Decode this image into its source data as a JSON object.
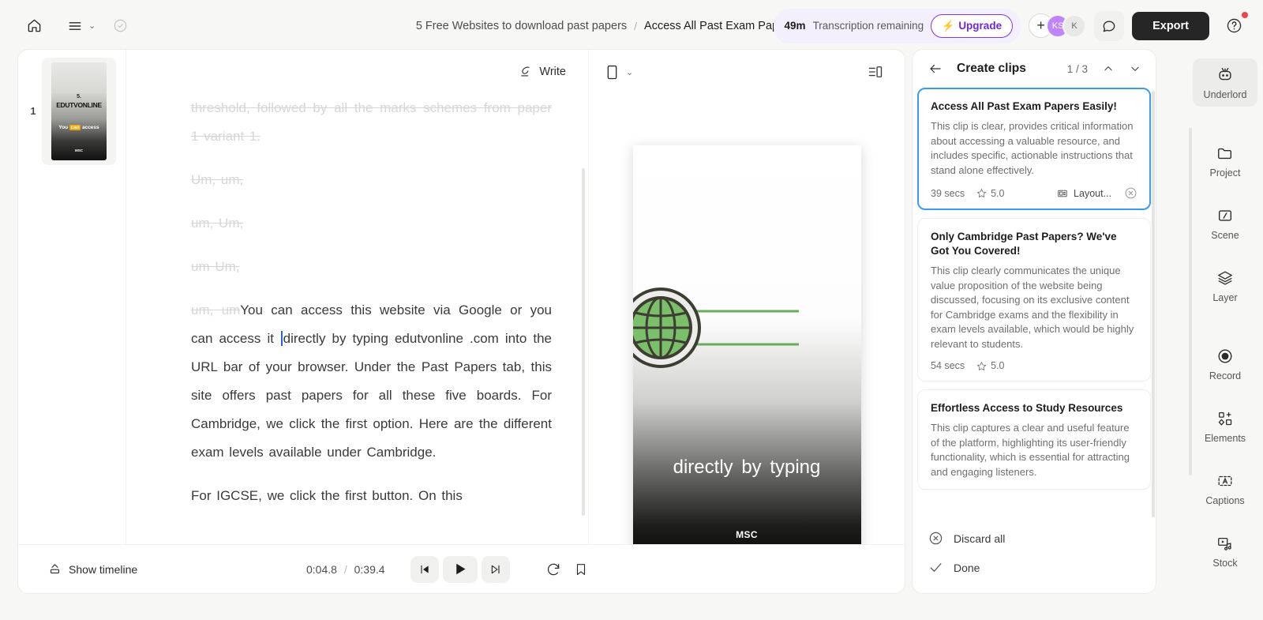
{
  "topbar": {
    "home_icon": "home-icon",
    "menu_icon": "hamburger-menu-icon",
    "menu_chevron": "⌄",
    "check_icon": "check-circle-icon",
    "breadcrumb_parent": "5 Free Websites to download past papers",
    "breadcrumb_sep": "/",
    "breadcrumb_current": "Access All Past Exam Papers Easily!",
    "breadcrumb_chevron": "⌄",
    "transcription_minutes": "49m",
    "transcription_label": "Transcription remaining",
    "upgrade_label": "Upgrade",
    "bolt_icon": "lightning-bolt-icon",
    "avatar_add": "+",
    "avatar_1": "KS",
    "avatar_2": "K",
    "chat_icon": "comment-bubble-icon",
    "export_label": "Export",
    "help_icon": "help-circle-icon",
    "accent_purple": "#6d28d9",
    "notification_red": "#ef4444"
  },
  "slides": [
    {
      "number": "1",
      "line1": "5.",
      "line2": "EDUTVONLINE",
      "caption_pre": "You ",
      "caption_hl": "can",
      "caption_post": " access",
      "footer": "MSC"
    }
  ],
  "transcript": {
    "write_label": "Write",
    "write_icon": "feather-pen-icon",
    "paragraphs": [
      {
        "text": "threshold, followed by all the marks schemes from paper 1 variant 1.",
        "muted": true
      },
      {
        "text": "Um, um,",
        "muted": true
      },
      {
        "text": "um, Um,",
        "muted": true
      },
      {
        "text": "um Um,",
        "muted": true
      }
    ],
    "active_paragraph": {
      "muted_prefix": "um, um",
      "before_caret": "You can access this website via Google or you can access it ",
      "after_caret": "directly by typing edutvonline .com into the URL bar of your browser. Under the Past Papers tab, this site offers past papers for all these five boards. For Cambridge, we click the first option. Here are the different exam levels available under Cambridge."
    },
    "next_paragraph": "For IGCSE, we click the first button. On this"
  },
  "player": {
    "ratio_icon": "portrait-frame-icon",
    "ratio_chevron": "⌄",
    "panel_toggle_icon": "panel-layout-icon",
    "video": {
      "caption": "directly by typing",
      "watermark": "MSC",
      "globe_icon": "globe-icon",
      "globe_color": "#7cbf6b",
      "line_color": "#6aab5c"
    },
    "controls": {
      "show_timeline_label": "Show timeline",
      "timeline_icon": "timeline-toggle-icon",
      "current_time": "0:04.8",
      "time_sep": "/",
      "total_time": "0:39.4",
      "prev_icon": "skip-previous-icon",
      "play_icon": "play-icon",
      "next_icon": "skip-next-icon",
      "loop_icon": "loop-speed-icon",
      "bookmark_icon": "bookmark-icon"
    }
  },
  "clips_panel": {
    "back_icon": "arrow-left-icon",
    "title": "Create clips",
    "counter": "1 / 3",
    "up_icon": "chevron-up-icon",
    "down_icon": "chevron-down-icon",
    "active_border": "#3b9bf0",
    "clips": [
      {
        "title": "Access All Past Exam Papers Easily!",
        "description": "This clip is clear, provides critical information about accessing a valuable resource, and includes specific, actionable instructions that stand alone effectively.",
        "secs": "39 secs",
        "rating": "5.0",
        "star_icon": "star-icon",
        "layout_label": "Layout...",
        "layout_icon": "layout-icon",
        "close_icon": "close-circle-icon",
        "active": true
      },
      {
        "title": "Only Cambridge Past Papers? We've Got You Covered!",
        "description": "This clip clearly communicates the unique value proposition of the website being discussed, focusing on its exclusive content for Cambridge exams and the flexibility in exam levels available, which would be highly relevant to students.",
        "secs": "54 secs",
        "rating": "5.0",
        "star_icon": "star-icon",
        "active": false
      },
      {
        "title": "Effortless Access to Study Resources",
        "description": "This clip captures a clear and useful feature of the platform, highlighting its user-friendly functionality, which is essential for attracting and engaging listeners.",
        "secs": "",
        "rating": "",
        "active": false
      }
    ],
    "discard_label": "Discard all",
    "discard_icon": "close-circle-icon",
    "done_label": "Done",
    "done_icon": "check-icon"
  },
  "rail": {
    "items": [
      {
        "label": "Underlord",
        "icon": "robot-icon",
        "active": true
      },
      {
        "label": "Project",
        "icon": "folder-icon",
        "active": false
      },
      {
        "label": "Scene",
        "icon": "scene-slash-icon",
        "active": false
      },
      {
        "label": "Layer",
        "icon": "layers-icon",
        "active": false
      },
      {
        "label": "Record",
        "icon": "record-dot-icon",
        "active": false
      },
      {
        "label": "Elements",
        "icon": "elements-shapes-icon",
        "active": false
      },
      {
        "label": "Captions",
        "icon": "captions-a-icon",
        "active": false
      },
      {
        "label": "Stock",
        "icon": "stock-media-icon",
        "active": false
      }
    ]
  }
}
